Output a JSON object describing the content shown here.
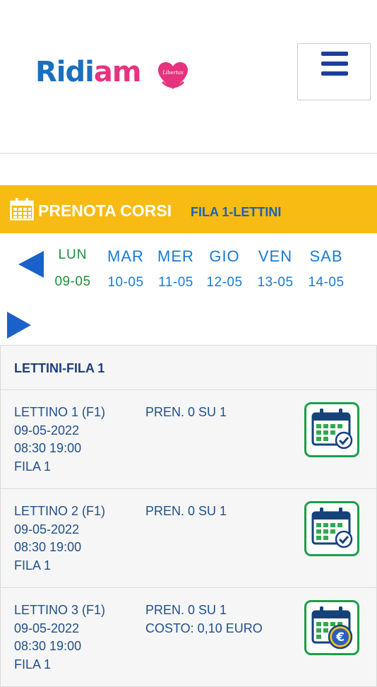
{
  "header": {
    "logo_part1": "Ridi",
    "logo_part2": "am",
    "logo_heart_text": "Libertas",
    "menu_label": "menu"
  },
  "banner": {
    "title": "PRENOTA CORSI",
    "subtitle": "FILA 1-LETTINI"
  },
  "days": [
    {
      "name": "LUN",
      "date": "09-05",
      "active": true
    },
    {
      "name": "MAR",
      "date": "10-05",
      "active": false
    },
    {
      "name": "MER",
      "date": "11-05",
      "active": false
    },
    {
      "name": "GIO",
      "date": "12-05",
      "active": false
    },
    {
      "name": "VEN",
      "date": "13-05",
      "active": false
    },
    {
      "name": "SAB",
      "date": "14-05",
      "active": false
    }
  ],
  "table": {
    "header": "LETTINI-FILA 1",
    "rows": [
      {
        "name": "LETTINO 1 (F1)",
        "date": "09-05-2022",
        "time": "08:30 19:00",
        "row_label": "FILA 1",
        "pren": "PREN. 0 SU 1",
        "cost": "",
        "icon": "calendar-check-icon"
      },
      {
        "name": "LETTINO 2 (F1)",
        "date": "09-05-2022",
        "time": "08:30 19:00",
        "row_label": "FILA 1",
        "pren": "PREN. 0 SU 1",
        "cost": "",
        "icon": "calendar-check-icon"
      },
      {
        "name": "LETTINO 3 (F1)",
        "date": "09-05-2022",
        "time": "08:30 19:00",
        "row_label": "FILA 1",
        "pren": "PREN. 0 SU 1",
        "cost": "COSTO: 0,10 EURO",
        "icon": "calendar-euro-icon"
      }
    ]
  },
  "colors": {
    "accent_blue": "#1a62c9",
    "banner_yellow": "#f7bb14",
    "active_green": "#1e8c3a",
    "brand_pink": "#e7337f"
  }
}
